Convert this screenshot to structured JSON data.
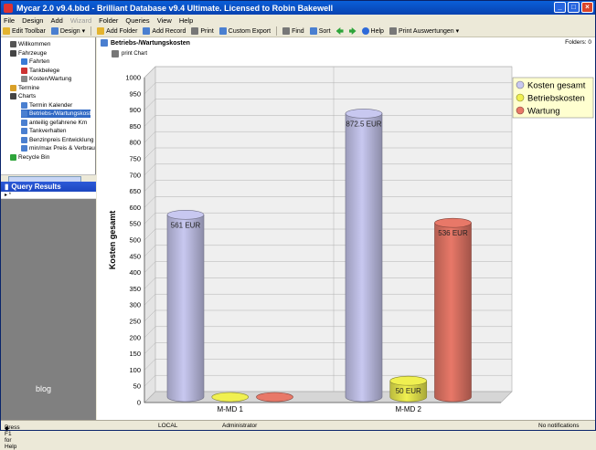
{
  "window": {
    "title": "Mycar 2.0 v9.4.bbd - Brilliant Database v9.4 Ultimate. Licensed to Robin Bakewell"
  },
  "menu": [
    "File",
    "Design",
    "Add",
    "Wizard",
    "Folder",
    "Queries",
    "View",
    "Help"
  ],
  "toolbar": {
    "edit_toolbar": "Edit Toolbar",
    "design": "Design",
    "add_folder": "Add Folder",
    "add_record": "Add Record",
    "print": "Print",
    "custom_export": "Custom Export",
    "find": "Find",
    "sort": "Sort",
    "help": "Help",
    "print_reports": "Print Auswertungen"
  },
  "tree": [
    {
      "label": "Willkommen",
      "indent": 1,
      "color": "#555555"
    },
    {
      "label": "Fahrzeuge",
      "indent": 1,
      "color": "#444444"
    },
    {
      "label": "Fahrten",
      "indent": 2,
      "color": "#3a7bd5"
    },
    {
      "label": "Tankbelege",
      "indent": 2,
      "color": "#cc3333"
    },
    {
      "label": "Kosten/Wartung",
      "indent": 2,
      "color": "#888888"
    },
    {
      "label": "Termine",
      "indent": 1,
      "color": "#d9a028"
    },
    {
      "label": "Charts",
      "indent": 1,
      "color": "#444444"
    },
    {
      "label": "Termin Kalender",
      "indent": 2,
      "color": "#4a7fd0"
    },
    {
      "label": "Betriebs-/Wartungskost",
      "indent": 2,
      "color": "#4a7fd0",
      "selected": true
    },
    {
      "label": "anteilig gefahrene Km",
      "indent": 2,
      "color": "#4a7fd0"
    },
    {
      "label": "Tankverhalten",
      "indent": 2,
      "color": "#4a7fd0"
    },
    {
      "label": "Benzinpreis Entwicklung",
      "indent": 2,
      "color": "#4a7fd0"
    },
    {
      "label": "min/max Preis & Verbrau",
      "indent": 2,
      "color": "#4a7fd0"
    },
    {
      "label": "Recycle Bin",
      "indent": 1,
      "color": "#2ea43a"
    }
  ],
  "query_results": {
    "title": "Query Results",
    "row_marker": "*"
  },
  "blog": "blog",
  "panel": {
    "title": "Betriebs-/Wartungskosten",
    "folders": "Folders: 0",
    "print_chart": "print Chart"
  },
  "chart_data": {
    "type": "bar",
    "categories": [
      "M-MD 1",
      "M-MD 2"
    ],
    "series": [
      {
        "name": "Kosten gesamt",
        "values": [
          561,
          872.5
        ],
        "labels": [
          "561 EUR",
          "872.5 EUR"
        ],
        "color": "#c8c8f0"
      },
      {
        "name": "Betriebskosten",
        "values": [
          0,
          50
        ],
        "labels": [
          "",
          "50 EUR"
        ],
        "color": "#f0f050"
      },
      {
        "name": "Wartung",
        "values": [
          0,
          536
        ],
        "labels": [
          "",
          "536 EUR"
        ],
        "color": "#e87868"
      }
    ],
    "ylabel": "Kosten gesamt",
    "ylim": [
      0,
      1000
    ],
    "yticks": [
      0,
      50,
      100,
      150,
      200,
      250,
      300,
      350,
      400,
      450,
      500,
      550,
      600,
      650,
      700,
      750,
      800,
      850,
      900,
      950,
      1000
    ],
    "grid": true,
    "legend_position": "top-right"
  },
  "status": {
    "hint": "Press F1 for Help",
    "mode": "LOCAL",
    "user": "Administrator",
    "notifications": "No notifications"
  }
}
